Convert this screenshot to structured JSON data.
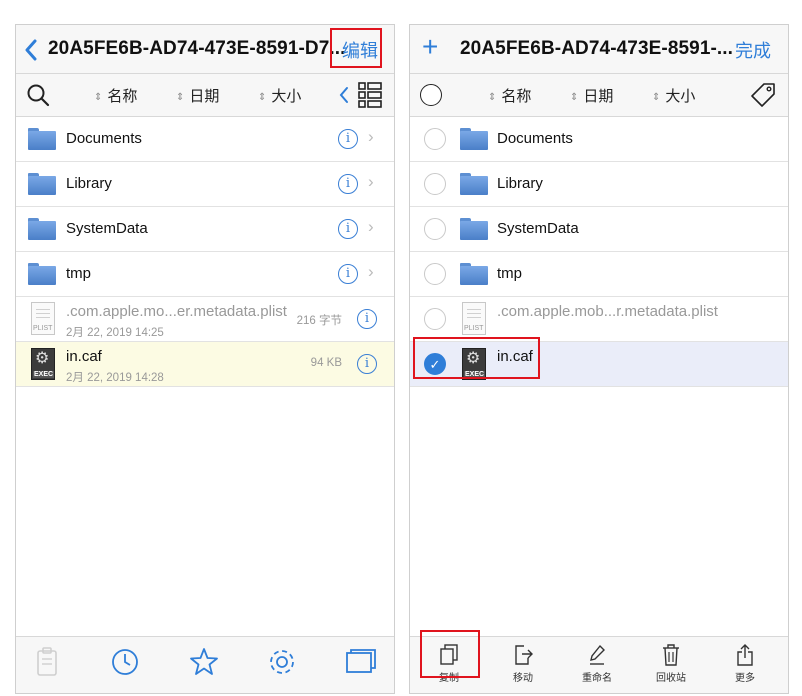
{
  "left_panel": {
    "title": "20A5FE6B-AD74-473E-8591-D7...",
    "edit_label": "编辑",
    "sort": {
      "name": "名称",
      "date": "日期",
      "size": "大小"
    },
    "files": [
      {
        "name": "Documents"
      },
      {
        "name": "Library"
      },
      {
        "name": "SystemData"
      },
      {
        "name": "tmp"
      },
      {
        "name": ".com.apple.mo...er.metadata.plist",
        "date": "2月 22, 2019 14:25",
        "size": "216 字节",
        "type_label": "PLIST"
      },
      {
        "name": "in.caf",
        "date": "2月 22, 2019 14:28",
        "size": "94 KB",
        "type_label": "EXEC"
      }
    ]
  },
  "right_panel": {
    "title": "20A5FE6B-AD74-473E-8591-...",
    "add_label": "+",
    "done_label": "完成",
    "sort": {
      "name": "名称",
      "date": "日期",
      "size": "大小"
    },
    "files": [
      {
        "name": "Documents"
      },
      {
        "name": "Library"
      },
      {
        "name": "SystemData"
      },
      {
        "name": "tmp"
      },
      {
        "name": ".com.apple.mob...r.metadata.plist",
        "type_label": "PLIST"
      },
      {
        "name": "in.caf",
        "type_label": "EXEC",
        "selected": true
      }
    ],
    "toolbar": {
      "copy": "复制",
      "move": "移动",
      "rename": "重命名",
      "recycle": "回收站",
      "more": "更多"
    }
  },
  "colors": {
    "accent": "#2f7ed8",
    "highlight_border": "#e0141e",
    "selected_row": "#eaedf9",
    "focused_row": "#fcfbe3"
  },
  "icons": {
    "info": "info-icon",
    "chevron": "chevron-right-icon",
    "checkmark": "checkmark-icon"
  }
}
